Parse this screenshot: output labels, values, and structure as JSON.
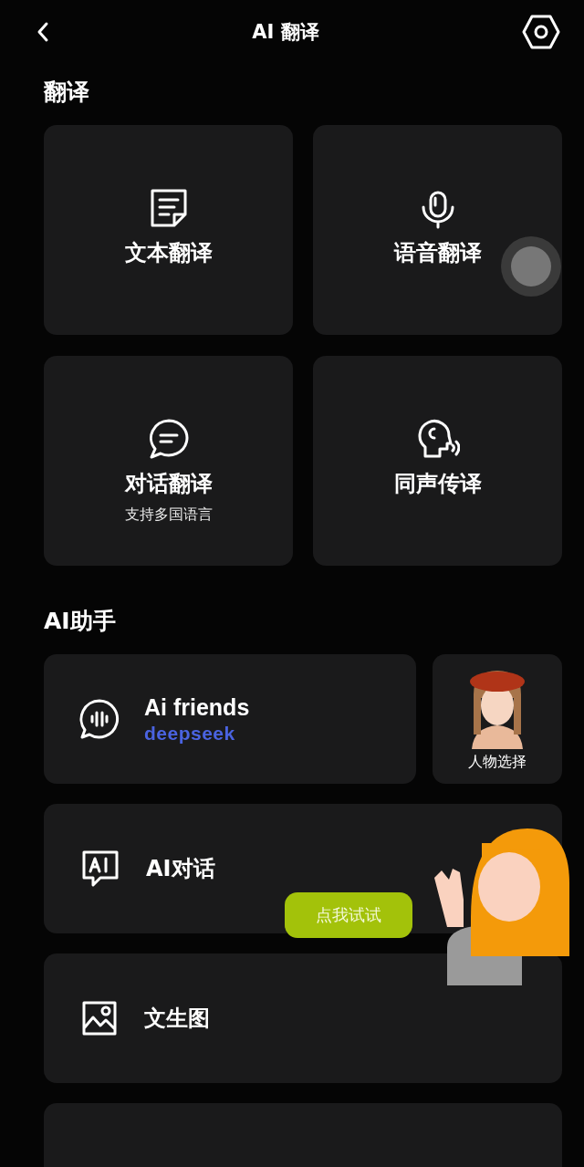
{
  "header": {
    "title": "AI 翻译"
  },
  "translate": {
    "title": "翻译",
    "tiles": [
      {
        "label": "文本翻译"
      },
      {
        "label": "语音翻译"
      },
      {
        "label": "对话翻译",
        "subtitle": "支持多国语言"
      },
      {
        "label": "同声传译"
      }
    ]
  },
  "assistant": {
    "title": "AI助手",
    "friends": {
      "label": "Ai friends",
      "brand": "deepseek"
    },
    "character": {
      "label": "人物选择"
    },
    "rows": [
      {
        "label": "AI对话"
      },
      {
        "label": "文生图"
      }
    ],
    "bubble": "点我试试"
  }
}
